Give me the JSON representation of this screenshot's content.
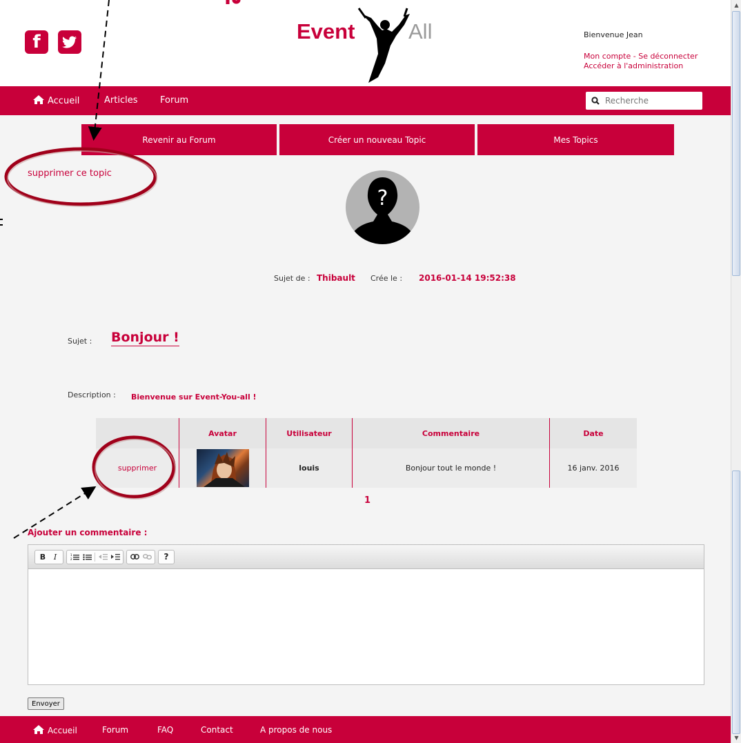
{
  "brand": {
    "word1": "Event",
    "word2": "All",
    "color": "#c8003a"
  },
  "social": [
    {
      "icon": "facebook-icon",
      "glyph": "f"
    },
    {
      "icon": "twitter-icon",
      "glyph": "t"
    }
  ],
  "user": {
    "welcome": "Bienvenue Jean",
    "account_links": "Mon compte - Se déconnecter",
    "admin_link": "Accéder à l'administration"
  },
  "nav": {
    "items": [
      "Accueil",
      "Articles",
      "Forum"
    ],
    "search_placeholder": "Recherche"
  },
  "forum_buttons": [
    "Revenir au Forum",
    "Créer un nouveau Topic",
    "Mes Topics"
  ],
  "topic": {
    "delete_label": "supprimer ce topic",
    "author_label": "Sujet de :",
    "author": "Thibault",
    "created_label": "Crée le :",
    "created": "2016-01-14 19:52:38",
    "subject_label": "Sujet :",
    "subject": "Bonjour !",
    "description_label": "Description :",
    "description": "Bienvenue sur Event-You-all !"
  },
  "comments_table": {
    "headers": [
      "",
      "Avatar",
      "Utilisateur",
      "Commentaire",
      "Date"
    ],
    "rows": [
      {
        "action": "supprimer",
        "user": "louis",
        "comment": "Bonjour tout le monde !",
        "date": "16 janv. 2016"
      }
    ]
  },
  "pager": {
    "current": "1"
  },
  "comment_form": {
    "title": "Ajouter un commentaire :",
    "submit": "Envoyer",
    "help_glyph": "?"
  },
  "footer": {
    "items": [
      "Accueil",
      "Forum",
      "FAQ",
      "Contact",
      "A propos de nous"
    ]
  }
}
